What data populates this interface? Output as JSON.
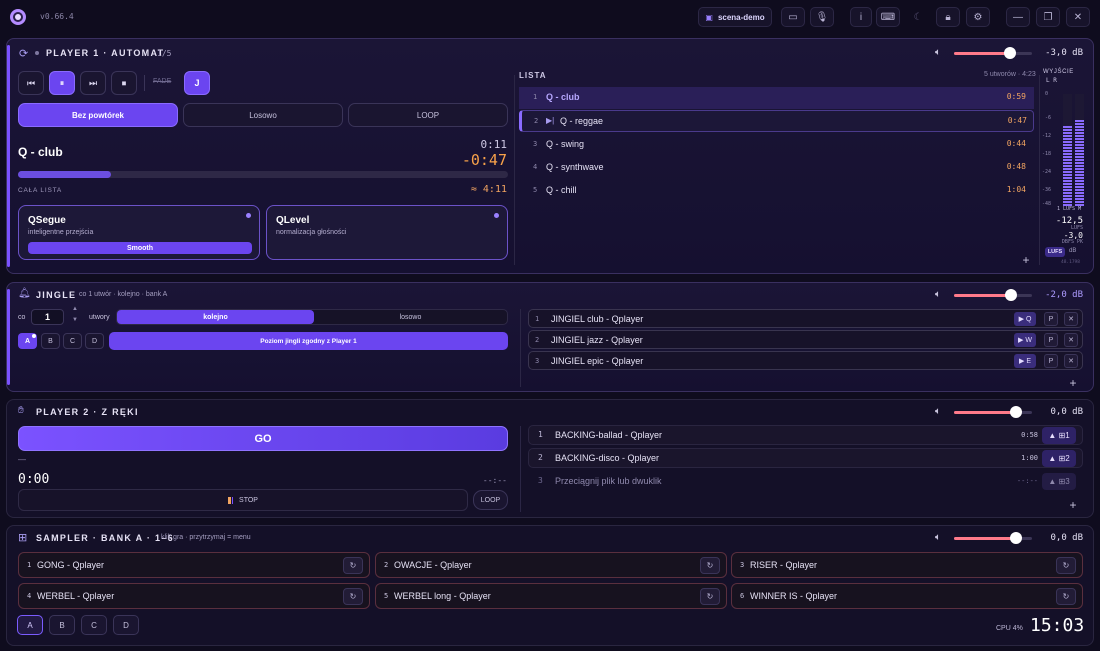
{
  "app": {
    "version": "v0.66.4",
    "scene_label": "scena-demo",
    "clock": "15:03",
    "cpu": "CPU 4%"
  },
  "toolbar": {
    "buttons": [
      "picture-in-picture-icon",
      "microphone-icon",
      "info-icon",
      "keyboard-icon",
      "moon-icon",
      "lock-icon",
      "gear-icon",
      "minimize-icon",
      "restore-icon",
      "close-icon"
    ]
  },
  "player1": {
    "title": "PLAYER 1 · AUTOMAT",
    "count": "1/5",
    "volume_db": "-3,0 dB",
    "volume_level": 0.72,
    "transport": {
      "prev": "⏮",
      "pause": "⏸",
      "next": "⏭",
      "stop": "⏹",
      "fade": "FADE",
      "jingle": "J"
    },
    "modes": [
      "Bez powtórek",
      "Losowo",
      "LOOP"
    ],
    "active_mode": 0,
    "current_track": "Q - club",
    "elapsed": "0:11",
    "remaining": "-0:47",
    "progress": 0.19,
    "whole_list_label": "CAŁA LISTA",
    "whole_list_time": "≈ 4:11",
    "qsegue": {
      "title": "QSegue",
      "subtitle": "inteligentne przejścia",
      "button": "Smooth"
    },
    "qlevel": {
      "title": "QLevel",
      "subtitle": "normalizacja głośności"
    },
    "list": {
      "title": "LISTA",
      "summary": "5 utworów · 4:23",
      "items": [
        {
          "n": "1",
          "title": "Q - club",
          "duration": "0:59"
        },
        {
          "n": "2",
          "title": "Q - reggae",
          "duration": "0:47"
        },
        {
          "n": "3",
          "title": "Q - swing",
          "duration": "0:44"
        },
        {
          "n": "4",
          "title": "Q - synthwave",
          "duration": "0:48"
        },
        {
          "n": "5",
          "title": "Q - chill",
          "duration": "1:04"
        }
      ]
    },
    "meter": {
      "title": "WYJŚCIE",
      "channels": "L  R",
      "scale": [
        "0",
        "-6",
        "-12",
        "-18",
        "-24",
        "-36",
        "-48"
      ],
      "lufs_label": "1 LUFS M",
      "lufs_value": "-12,5",
      "lufs_unit": "LUFS",
      "dbfs_value": "-3,0",
      "dbfs_unit": "DBFS PK",
      "mode_on": "LUFS",
      "mode_off": "dB",
      "rate": "48.1798",
      "level_l": 0.72,
      "level_r": 0.78
    }
  },
  "jingle": {
    "title": "JINGLE",
    "subtitle": "co 1 utwór · kolejno · bank A",
    "volume_db": "-2,0 dB",
    "volume_level": 0.73,
    "every_label": "co",
    "every_value": "1",
    "every_unit": "utwory",
    "order_modes": [
      "kolejno",
      "losowo"
    ],
    "banks": [
      "A",
      "B",
      "C",
      "D"
    ],
    "level_button": "Poziom jingli zgodny z Player 1",
    "items": [
      {
        "n": "1",
        "title": "JINGIEL club - Qplayer",
        "key": "▶ Q"
      },
      {
        "n": "2",
        "title": "JINGIEL jazz - Qplayer",
        "key": "▶ W"
      },
      {
        "n": "3",
        "title": "JINGIEL epic - Qplayer",
        "key": "▶ E"
      }
    ],
    "item_p": "P",
    "item_x": "✕"
  },
  "player2": {
    "title": "PLAYER 2 · Z RĘKI",
    "volume_db": "0,0 dB",
    "volume_level": 0.8,
    "go_label": "GO",
    "track_name": "—",
    "elapsed": "0:00",
    "remaining": "--:--",
    "stop_label": "STOP",
    "loop_label": "LOOP",
    "items": [
      {
        "n": "1",
        "title": "BACKING-ballad - Qplayer",
        "duration": "0:58",
        "key": "▲ ⊞1"
      },
      {
        "n": "2",
        "title": "BACKING-disco - Qplayer",
        "duration": "1:00",
        "key": "▲ ⊞2"
      },
      {
        "n": "3",
        "title": "Przeciągnij plik lub dwuklik",
        "duration": "--:--",
        "key": "▲ ⊞3"
      }
    ]
  },
  "sampler": {
    "title": "SAMPLER · BANK A · 1–6",
    "hint": "klik gra · przytrzymaj = menu",
    "volume_db": "0,0 dB",
    "volume_level": 0.8,
    "pads": [
      {
        "n": "1",
        "title": "GONG - Qplayer"
      },
      {
        "n": "2",
        "title": "OWACJE - Qplayer"
      },
      {
        "n": "3",
        "title": "RISER - Qplayer"
      },
      {
        "n": "4",
        "title": "WERBEL - Qplayer"
      },
      {
        "n": "5",
        "title": "WERBEL long - Qplayer"
      },
      {
        "n": "6",
        "title": "WINNER IS - Qplayer"
      }
    ],
    "banks": [
      "A",
      "B",
      "C",
      "D"
    ],
    "reload_glyph": "↻"
  },
  "colors": {
    "accent": "#6b45f0",
    "duration": "#f1a461",
    "remaining": "#f7a14a",
    "volume": "#ff7a8a",
    "meter": "#8a6bff"
  }
}
